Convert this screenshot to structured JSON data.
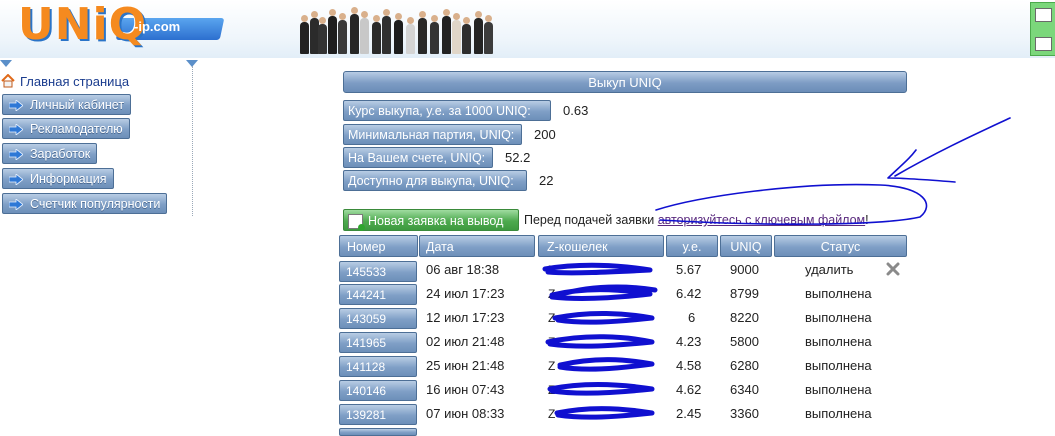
{
  "header": {
    "logo_text": "UNiQ",
    "logo_sub": "-ip.com"
  },
  "sidebar": {
    "home_label": "Главная страница",
    "items": [
      {
        "label": "Личный кабинет"
      },
      {
        "label": "Рекламодателю"
      },
      {
        "label": "Заработок"
      },
      {
        "label": "Информация"
      },
      {
        "label": "Счетчик популярности"
      }
    ]
  },
  "main": {
    "title": "Выкуп UNIQ",
    "info": [
      {
        "label": "Курс выкупа, у.е. за 1000 UNIQ:",
        "value": "0.63"
      },
      {
        "label": "Минимальная партия, UNIQ:",
        "value": "200"
      },
      {
        "label": "На Вашем счете, UNIQ:",
        "value": "52.2"
      },
      {
        "label": "Доступно для выкупа, UNIQ:",
        "value": "22"
      }
    ],
    "new_request_label": "Новая заявка на вывод",
    "notice_text": "Перед подачей заявки ",
    "notice_link": "авторизуйтесь с ключевым файлом",
    "notice_end": "!"
  },
  "table": {
    "headers": {
      "number": "Номер",
      "date": "Дата",
      "wallet": "Z-кошелек",
      "ue": "у.е.",
      "uniq": "UNIQ",
      "status": "Статус"
    },
    "rows": [
      {
        "number": "145533",
        "date": "06 авг 18:38",
        "wallet": "Z",
        "ue": "5.67",
        "uniq": "9000",
        "status": "удалить"
      },
      {
        "number": "144241",
        "date": "24 июл 17:23",
        "wallet": "Z",
        "ue": "6.42",
        "uniq": "8799",
        "status": "выполнена"
      },
      {
        "number": "143059",
        "date": "12 июл 17:23",
        "wallet": "Z",
        "ue": "6",
        "uniq": "8220",
        "status": "выполнена"
      },
      {
        "number": "141965",
        "date": "02 июл 21:48",
        "wallet": "Z",
        "ue": "4.23",
        "uniq": "5800",
        "status": "выполнена"
      },
      {
        "number": "141128",
        "date": "25 июн 21:48",
        "wallet": "Z",
        "ue": "4.58",
        "uniq": "6280",
        "status": "выполнена"
      },
      {
        "number": "140146",
        "date": "16 июн 07:43",
        "wallet": "Z",
        "ue": "4.62",
        "uniq": "6340",
        "status": "выполнена"
      },
      {
        "number": "139281",
        "date": "07 июн 08:33",
        "wallet": "Z",
        "ue": "2.45",
        "uniq": "3360",
        "status": "выполнена"
      }
    ]
  },
  "colors": {
    "button_blue": "#7f9fc6",
    "button_green": "#4eaa4f",
    "logo_orange": "#f58a1f",
    "annotation_ink": "#1010d0"
  },
  "icons": [
    "home-icon",
    "arrow-right-icon",
    "add-document-icon",
    "delete-x-icon",
    "contact-icon",
    "mail-icon"
  ]
}
